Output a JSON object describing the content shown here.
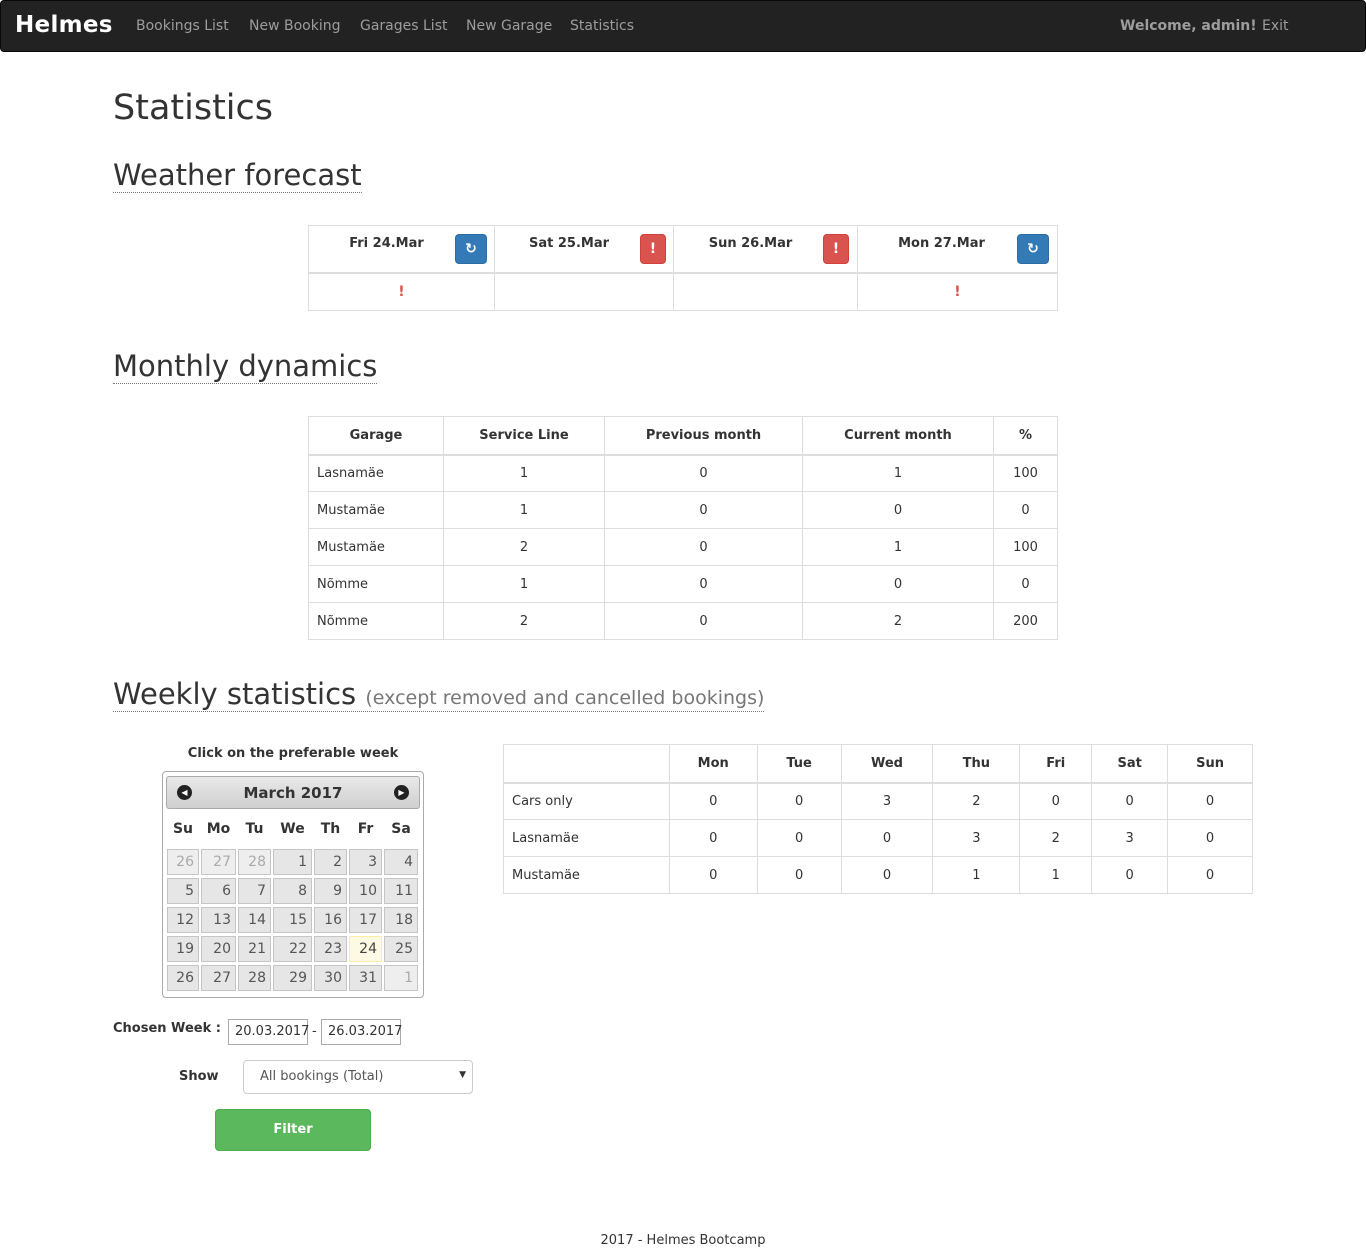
{
  "nav": {
    "brand": "Helmes",
    "links": [
      "Bookings List",
      "New Booking",
      "Garages List",
      "New Garage",
      "Statistics"
    ],
    "welcome": "Welcome, admin!",
    "exit": "Exit"
  },
  "page_title": "Statistics",
  "weather": {
    "title": "Weather forecast",
    "days": [
      {
        "label": "Fri 24.Mar",
        "icon": "refresh-icon",
        "alert": "!"
      },
      {
        "label": "Sat 25.Mar",
        "icon": "exclamation-icon",
        "alert": ""
      },
      {
        "label": "Sun 26.Mar",
        "icon": "exclamation-icon",
        "alert": ""
      },
      {
        "label": "Mon 27.Mar",
        "icon": "refresh-icon",
        "alert": "!"
      }
    ],
    "refresh_glyph": "↻",
    "warning_glyph": "!"
  },
  "monthly": {
    "title": "Monthly dynamics",
    "headers": [
      "Garage",
      "Service Line",
      "Previous month",
      "Current month",
      "%"
    ],
    "rows": [
      [
        "Lasnamäe",
        "1",
        "0",
        "1",
        "100"
      ],
      [
        "Mustamäe",
        "1",
        "0",
        "0",
        "0"
      ],
      [
        "Mustamäe",
        "2",
        "0",
        "1",
        "100"
      ],
      [
        "Nõmme",
        "1",
        "0",
        "0",
        "0"
      ],
      [
        "Nõmme",
        "2",
        "0",
        "2",
        "200"
      ]
    ]
  },
  "weekly": {
    "title": "Weekly statistics",
    "subtitle": "(except removed and cancelled bookings)",
    "calendar_caption": "Click on the preferable week",
    "calendar": {
      "month": "March 2017",
      "dow": [
        "Su",
        "Mo",
        "Tu",
        "We",
        "Th",
        "Fr",
        "Sa"
      ],
      "weeks": [
        [
          "26",
          "27",
          "28",
          "1",
          "2",
          "3",
          "4"
        ],
        [
          "5",
          "6",
          "7",
          "8",
          "9",
          "10",
          "11"
        ],
        [
          "12",
          "13",
          "14",
          "15",
          "16",
          "17",
          "18"
        ],
        [
          "19",
          "20",
          "21",
          "22",
          "23",
          "24",
          "25"
        ],
        [
          "26",
          "27",
          "28",
          "29",
          "30",
          "31",
          "1"
        ]
      ],
      "today": "24"
    },
    "chosen_week_label": "Chosen Week :",
    "week_start": "20.03.2017",
    "week_sep": "-",
    "week_end": "26.03.2017",
    "show_label": "Show",
    "show_value": "All bookings (Total)",
    "filter_label": "Filter",
    "table_headers": [
      "",
      "Mon",
      "Tue",
      "Wed",
      "Thu",
      "Fri",
      "Sat",
      "Sun"
    ],
    "table_rows": [
      [
        "Cars only",
        "0",
        "0",
        "3",
        "2",
        "0",
        "0",
        "0"
      ],
      [
        "Lasnamäe",
        "0",
        "0",
        "0",
        "3",
        "2",
        "3",
        "0"
      ],
      [
        "Mustamäe",
        "0",
        "0",
        "0",
        "1",
        "1",
        "0",
        "0"
      ]
    ]
  },
  "footer": "2017 - Helmes Bootcamp"
}
